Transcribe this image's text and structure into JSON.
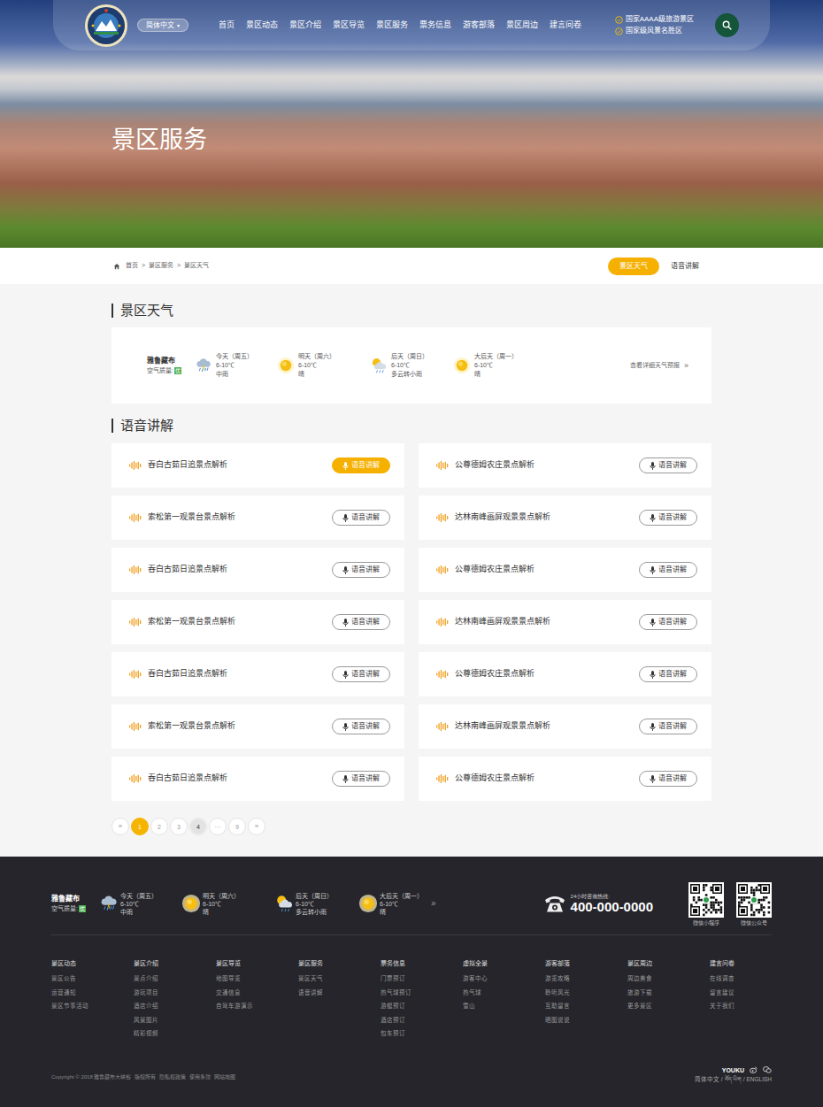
{
  "header": {
    "language": "简体中文",
    "language_caret": "▾",
    "nav": [
      {
        "label": "首页",
        "selected": false
      },
      {
        "label": "景区动态",
        "selected": false
      },
      {
        "label": "景区介绍",
        "selected": false
      },
      {
        "label": "景区导览",
        "selected": false
      },
      {
        "label": "景区服务",
        "selected": false
      },
      {
        "label": "票务信息",
        "selected": false
      },
      {
        "label": "游客部落",
        "selected": false
      },
      {
        "label": "景区周边",
        "selected": false
      },
      {
        "label": "建言问卷",
        "selected": false
      }
    ],
    "badges": [
      "国家AAAA级旅游景区",
      "国家级风景名胜区"
    ]
  },
  "hero": {
    "title": "景区服务"
  },
  "breadcrumb": {
    "items": [
      "首页",
      "景区服务",
      "景区天气"
    ],
    "separator": ">"
  },
  "subtabs": [
    {
      "label": "景区天气",
      "selected": true
    },
    {
      "label": "语音讲解",
      "selected": false
    }
  ],
  "weather_section": {
    "title": "景区天气",
    "location": "雅鲁藏布",
    "air_label": "空气质量:",
    "air_value": "优",
    "days": [
      {
        "label": "今天（周五）",
        "temp": "6-10℃",
        "desc": "中雨",
        "kind": "rain"
      },
      {
        "label": "明天（周六）",
        "temp": "6-10℃",
        "desc": "晴",
        "kind": "sunny"
      },
      {
        "label": "后天（周日）",
        "temp": "6-10℃",
        "desc": "多云转小雨",
        "kind": "cloudy-rain"
      },
      {
        "label": "大后天（周一）",
        "temp": "6-10℃",
        "desc": "晴",
        "kind": "sunny"
      }
    ],
    "link": "查看详细天气预报",
    "link_arrow": "»"
  },
  "audio_section": {
    "title": "语音讲解",
    "items": [
      {
        "title": "吞白古茹日追景点解析",
        "button": "语音讲解",
        "selected": true
      },
      {
        "title": "公尊德姆农庄景点解析",
        "button": "语音讲解",
        "selected": false
      },
      {
        "title": "索松第一观景台景点解析",
        "button": "语音讲解",
        "selected": false
      },
      {
        "title": "达林南峰画屏观景景点解析",
        "button": "语音讲解",
        "selected": false
      },
      {
        "title": "吞白古茹日追景点解析",
        "button": "语音讲解",
        "selected": false
      },
      {
        "title": "公尊德姆农庄景点解析",
        "button": "语音讲解",
        "selected": false
      },
      {
        "title": "索松第一观景台景点解析",
        "button": "语音讲解",
        "selected": false
      },
      {
        "title": "达林南峰画屏观景景点解析",
        "button": "语音讲解",
        "selected": false
      },
      {
        "title": "吞白古茹日追景点解析",
        "button": "语音讲解",
        "selected": false
      },
      {
        "title": "公尊德姆农庄景点解析",
        "button": "语音讲解",
        "selected": false
      },
      {
        "title": "索松第一观景台景点解析",
        "button": "语音讲解",
        "selected": false
      },
      {
        "title": "达林南峰画屏观景景点解析",
        "button": "语音讲解",
        "selected": false
      },
      {
        "title": "吞白古茹日追景点解析",
        "button": "语音讲解",
        "selected": false
      },
      {
        "title": "公尊德姆农庄景点解析",
        "button": "语音讲解",
        "selected": false
      }
    ]
  },
  "pagination": {
    "prev": "«",
    "next": "»",
    "pages": [
      {
        "label": "1",
        "selected": true,
        "highlighted": false
      },
      {
        "label": "2",
        "selected": false,
        "highlighted": false
      },
      {
        "label": "3",
        "selected": false,
        "highlighted": false
      },
      {
        "label": "4",
        "selected": false,
        "highlighted": true
      },
      {
        "label": "···",
        "selected": false,
        "highlighted": false
      },
      {
        "label": "9",
        "selected": false,
        "highlighted": false
      }
    ]
  },
  "footer": {
    "weather": {
      "location": "雅鲁藏布",
      "air_label": "空气质量:",
      "air_value": "优",
      "days": [
        {
          "label": "今天（周五）",
          "temp": "6-10℃",
          "desc": "中雨",
          "kind": "rain"
        },
        {
          "label": "明天（周六）",
          "temp": "6-10℃",
          "desc": "晴",
          "kind": "sunny"
        },
        {
          "label": "后天（周日）",
          "temp": "6-10℃",
          "desc": "多云转小雨",
          "kind": "cloudy-rain"
        },
        {
          "label": "大后天（周一）",
          "temp": "6-10℃",
          "desc": "晴",
          "kind": "sunny"
        }
      ],
      "more": "»"
    },
    "hotline_label": "24小时咨询热线:",
    "hotline": "400-000-0000",
    "qrcodes": [
      "微信小程序",
      "微信公众号"
    ],
    "columns": [
      {
        "title": "景区动态",
        "links": [
          "景区公告",
          "运营通知",
          "景区节事活动"
        ]
      },
      {
        "title": "景区介绍",
        "links": [
          "景点介绍",
          "游玩项目",
          "酒店介绍",
          "风景图片",
          "精彩视频"
        ]
      },
      {
        "title": "景区导览",
        "links": [
          "地图导览",
          "交通信息",
          "自驾车游演示"
        ]
      },
      {
        "title": "景区服务",
        "links": [
          "景区天气",
          "语音讲解"
        ]
      },
      {
        "title": "票务信息",
        "links": [
          "门票预订",
          "热气球预订",
          "游艇预订",
          "酒店预订",
          "包车预订"
        ]
      },
      {
        "title": "虚拟全景",
        "links": [
          "游客中心",
          "热气球",
          "雪山"
        ]
      },
      {
        "title": "游客部落",
        "links": [
          "游览攻略",
          "聆听风光",
          "互助留言",
          "晒图说说"
        ]
      },
      {
        "title": "景区周边",
        "links": [
          "周边美食",
          "旅游下载",
          "更多景区"
        ]
      },
      {
        "title": "建言问卷",
        "links": [
          "在线调查",
          "留言建议",
          "关于我们"
        ]
      }
    ],
    "copyright": "Copyright © 2018 雅鲁藏布大峡谷",
    "legal": [
      "版权所有",
      "隐私权政策",
      "使用条款",
      "网站地图"
    ],
    "video": "YOUKU",
    "languages": [
      "简体中文",
      "བོད་ཡིག",
      "ENGLISH"
    ],
    "language_separator": "/"
  }
}
